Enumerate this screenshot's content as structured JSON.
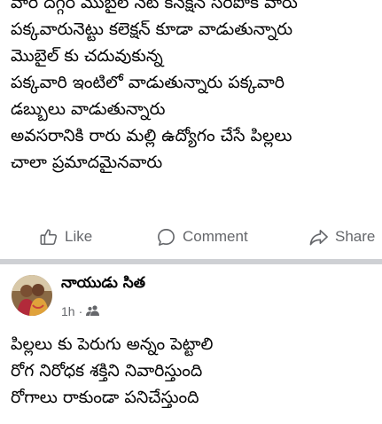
{
  "post1": {
    "lines": [
      "వారి దగ్గర మొబైల్ నెట్ కనెక్షన్ సరిపోక వారు",
      "పక్కవారునెట్టు కలెక్షన్ కూడా వాడుతున్నారు",
      "మొబైల్ కు చదువుకున్న",
      "పక్కవారి ఇంటిలో వాడుతున్నారు పక్కవారి",
      "డబ్బులు వాడుతున్నారు",
      "అవసరానికి రారు మల్లి ఉద్యోగం చేసే పిల్లలు",
      "చాలా ప్రమాదమైనవారు"
    ],
    "actions": {
      "like": "Like",
      "comment": "Comment",
      "share": "Share"
    }
  },
  "post2": {
    "author": "నాయుడు సిత",
    "time": "1h",
    "separator": "·",
    "audience_icon": "friends-icon",
    "lines": [
      "పిల్లలు కు పెరుగు అన్నం పెట్టాలి",
      "రోగ నిరోధక శక్తిని నివారిస్తుంది",
      "రోగాలు రాకుండా పనిచేస్తుంది"
    ]
  },
  "colors": {
    "text": "#050505",
    "secondary": "#65676b",
    "divider": "#ced0d4"
  }
}
